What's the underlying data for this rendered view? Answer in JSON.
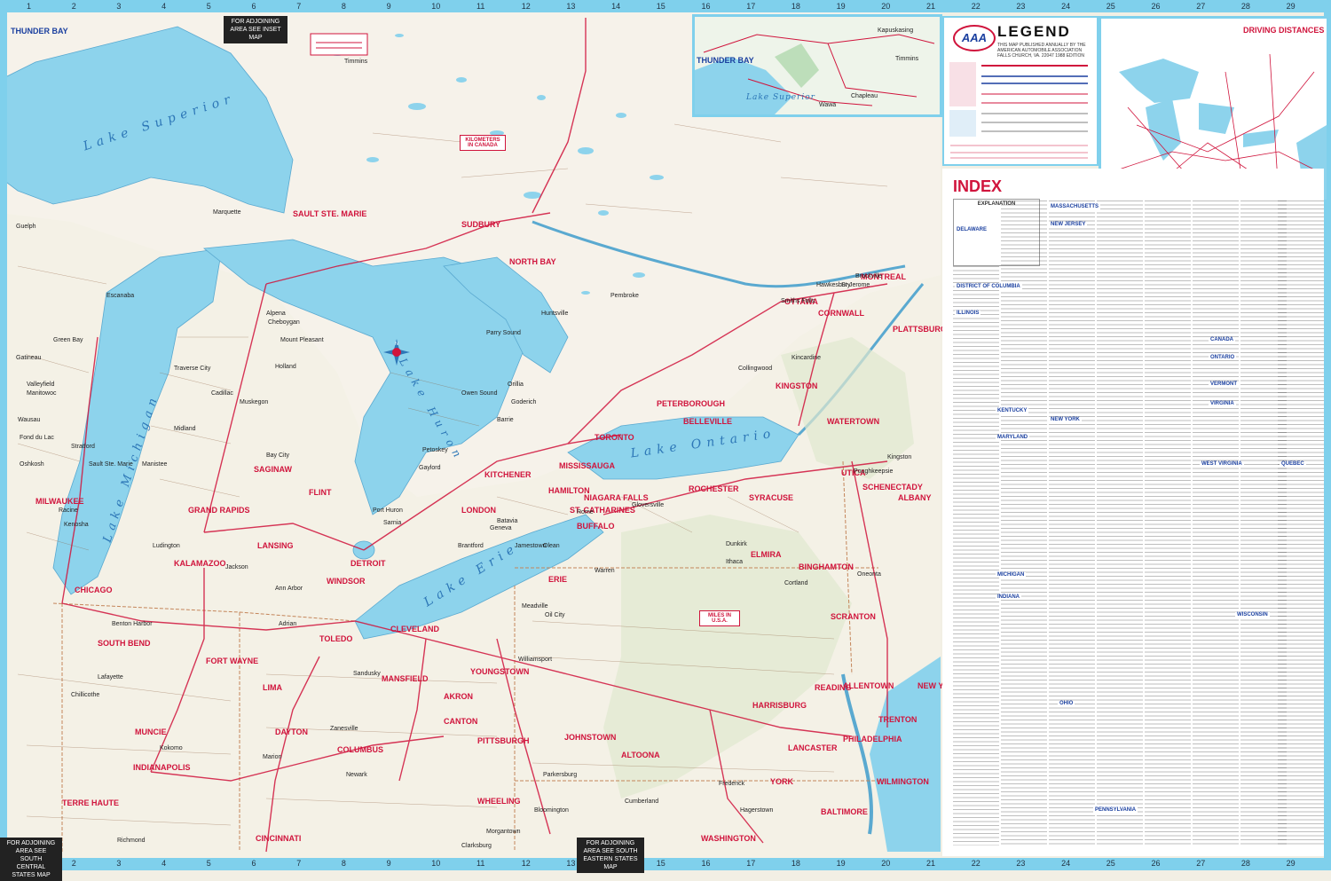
{
  "grid_top": [
    "1",
    "2",
    "3",
    "4",
    "5",
    "6",
    "7",
    "8",
    "9",
    "10",
    "11",
    "12",
    "13",
    "14",
    "15",
    "16",
    "17",
    "18",
    "19",
    "20",
    "21",
    "22",
    "23",
    "24",
    "25",
    "26",
    "27",
    "28",
    "29",
    "30"
  ],
  "grid_bottom": [
    "1",
    "2",
    "3",
    "4",
    "5",
    "6",
    "7",
    "8",
    "9",
    "10",
    "11",
    "12",
    "13",
    "14",
    "15",
    "16",
    "17",
    "18",
    "19",
    "20",
    "21",
    "22",
    "23",
    "24",
    "25",
    "26",
    "27",
    "28",
    "29",
    "30"
  ],
  "legend": {
    "title": "LEGEND",
    "logo": "AAA",
    "publisher_note": "THIS MAP PUBLISHED ANNUALLY BY THE AMERICAN AUTOMOBILE ASSOCIATION FALLS CHURCH, VA. 22047 1988 EDITION"
  },
  "index": {
    "title": "INDEX",
    "explanation_title": "EXPLANATION",
    "section_heads": [
      "DELAWARE",
      "DISTRICT OF COLUMBIA",
      "ILLINOIS",
      "INDIANA",
      "KENTUCKY",
      "MARYLAND",
      "MICHIGAN",
      "NEW JERSEY",
      "NEW YORK",
      "OHIO",
      "PENNSYLVANIA",
      "VERMONT",
      "VIRGINIA",
      "WEST VIRGINIA",
      "WISCONSIN",
      "CANADA",
      "ONTARIO",
      "QUEBEC",
      "MASSACHUSETTS"
    ]
  },
  "driving_distances": {
    "title": "DRIVING DISTANCES"
  },
  "inset": {
    "labels": [
      "THUNDER BAY",
      "Lake Superior",
      "Kapuskasing",
      "Timmins",
      "Chapleau",
      "Wawa"
    ]
  },
  "adjoining": {
    "top": "FOR ADJOINING AREA SEE INSET MAP",
    "bottom_left": "FOR ADJOINING AREA SEE SOUTH CENTRAL STATES MAP",
    "bottom_mid": "FOR ADJOINING AREA SEE SOUTH EASTERN STATES MAP"
  },
  "km_box": "KILOMETERS IN CANADA",
  "miles_box": "MILES IN U.S.A.",
  "lakes": [
    "Lake Superior",
    "Lake Michigan",
    "Lake Huron",
    "Lake Erie",
    "Lake Ontario"
  ],
  "cities_major": [
    "THUNDER BAY",
    "CHICAGO",
    "MILWAUKEE",
    "DETROIT",
    "TORONTO",
    "MISSISSAUGA",
    "HAMILTON",
    "BUFFALO",
    "CLEVELAND",
    "PITTSBURGH",
    "INDIANAPOLIS",
    "CINCINNATI",
    "COLUMBUS",
    "PHILADELPHIA",
    "BALTIMORE",
    "WASHINGTON",
    "OTTAWA",
    "MONTREAL",
    "ROCHESTER",
    "SYRACUSE",
    "ALBANY",
    "TOLEDO",
    "AKRON",
    "CANTON",
    "SUDBURY",
    "LONDON",
    "KITCHENER",
    "FLINT",
    "LANSING",
    "GRAND RAPIDS",
    "FORT WAYNE",
    "SOUTH BEND",
    "DAYTON",
    "ERIE",
    "SCRANTON",
    "ALLENTOWN",
    "HARRISBURG",
    "NEW YORK",
    "UTICA",
    "KINGSTON",
    "SAGINAW",
    "WINDSOR",
    "YOUNGSTOWN",
    "READING",
    "TRENTON",
    "BINGHAMTON",
    "KALAMAZOO",
    "SAULT STE. MARIE",
    "NORTH BAY",
    "WHEELING",
    "TERRE HAUTE",
    "MUNCIE",
    "LIMA",
    "MANSFIELD",
    "ALTOONA",
    "JOHNSTOWN",
    "YORK",
    "LANCASTER",
    "WILMINGTON",
    "PETERBOROUGH",
    "BELLEVILLE",
    "CORNWALL",
    "NIAGARA FALLS",
    "ST. CATHARINES",
    "ELMIRA",
    "SCHENECTADY",
    "PLATTSBURGH",
    "WATERTOWN"
  ],
  "cities_minor": [
    "Timmins",
    "Marquette",
    "Escanaba",
    "Green Bay",
    "Traverse City",
    "Cadillac",
    "Midland",
    "Bay City",
    "Port Huron",
    "Sarnia",
    "Owen Sound",
    "Barrie",
    "Orillia",
    "Huntsville",
    "Parry Sound",
    "Pembroke",
    "Kenosha",
    "Racine",
    "Benton Harbor",
    "Jackson",
    "Ann Arbor",
    "Adrian",
    "Sandusky",
    "Marion",
    "Zanesville",
    "Newark",
    "Chillicothe",
    "Lafayette",
    "Kokomo",
    "Richmond",
    "Bloomington",
    "Morgantown",
    "Clarksburg",
    "Parkersburg",
    "Cumberland",
    "Hagerstown",
    "Frederick",
    "Williamsport",
    "Oil City",
    "Meadville",
    "Warren",
    "Olean",
    "Jamestown",
    "Dunkirk",
    "Ithaca",
    "Cortland",
    "Oneonta",
    "Kingston",
    "Poughkeepsie",
    "Gloversville",
    "Rome",
    "Geneva",
    "Batavia",
    "Brantford",
    "Guelph",
    "Stratford",
    "Sault Ste. Marie",
    "Manistee",
    "Ludington",
    "Muskegon",
    "Holland",
    "Mount Pleasant",
    "Alpena",
    "Cheboygan",
    "Petoskey",
    "Gaylord",
    "Goderich",
    "Kincardine",
    "Collingwood",
    "Brockville",
    "Smiths Falls",
    "Hawkesbury",
    "St-Jerome",
    "Gatineau",
    "Valleyfield",
    "Wausau",
    "Oshkosh",
    "Fond du Lac",
    "Manitowoc",
    "Sheboygan",
    "Appleton"
  ]
}
